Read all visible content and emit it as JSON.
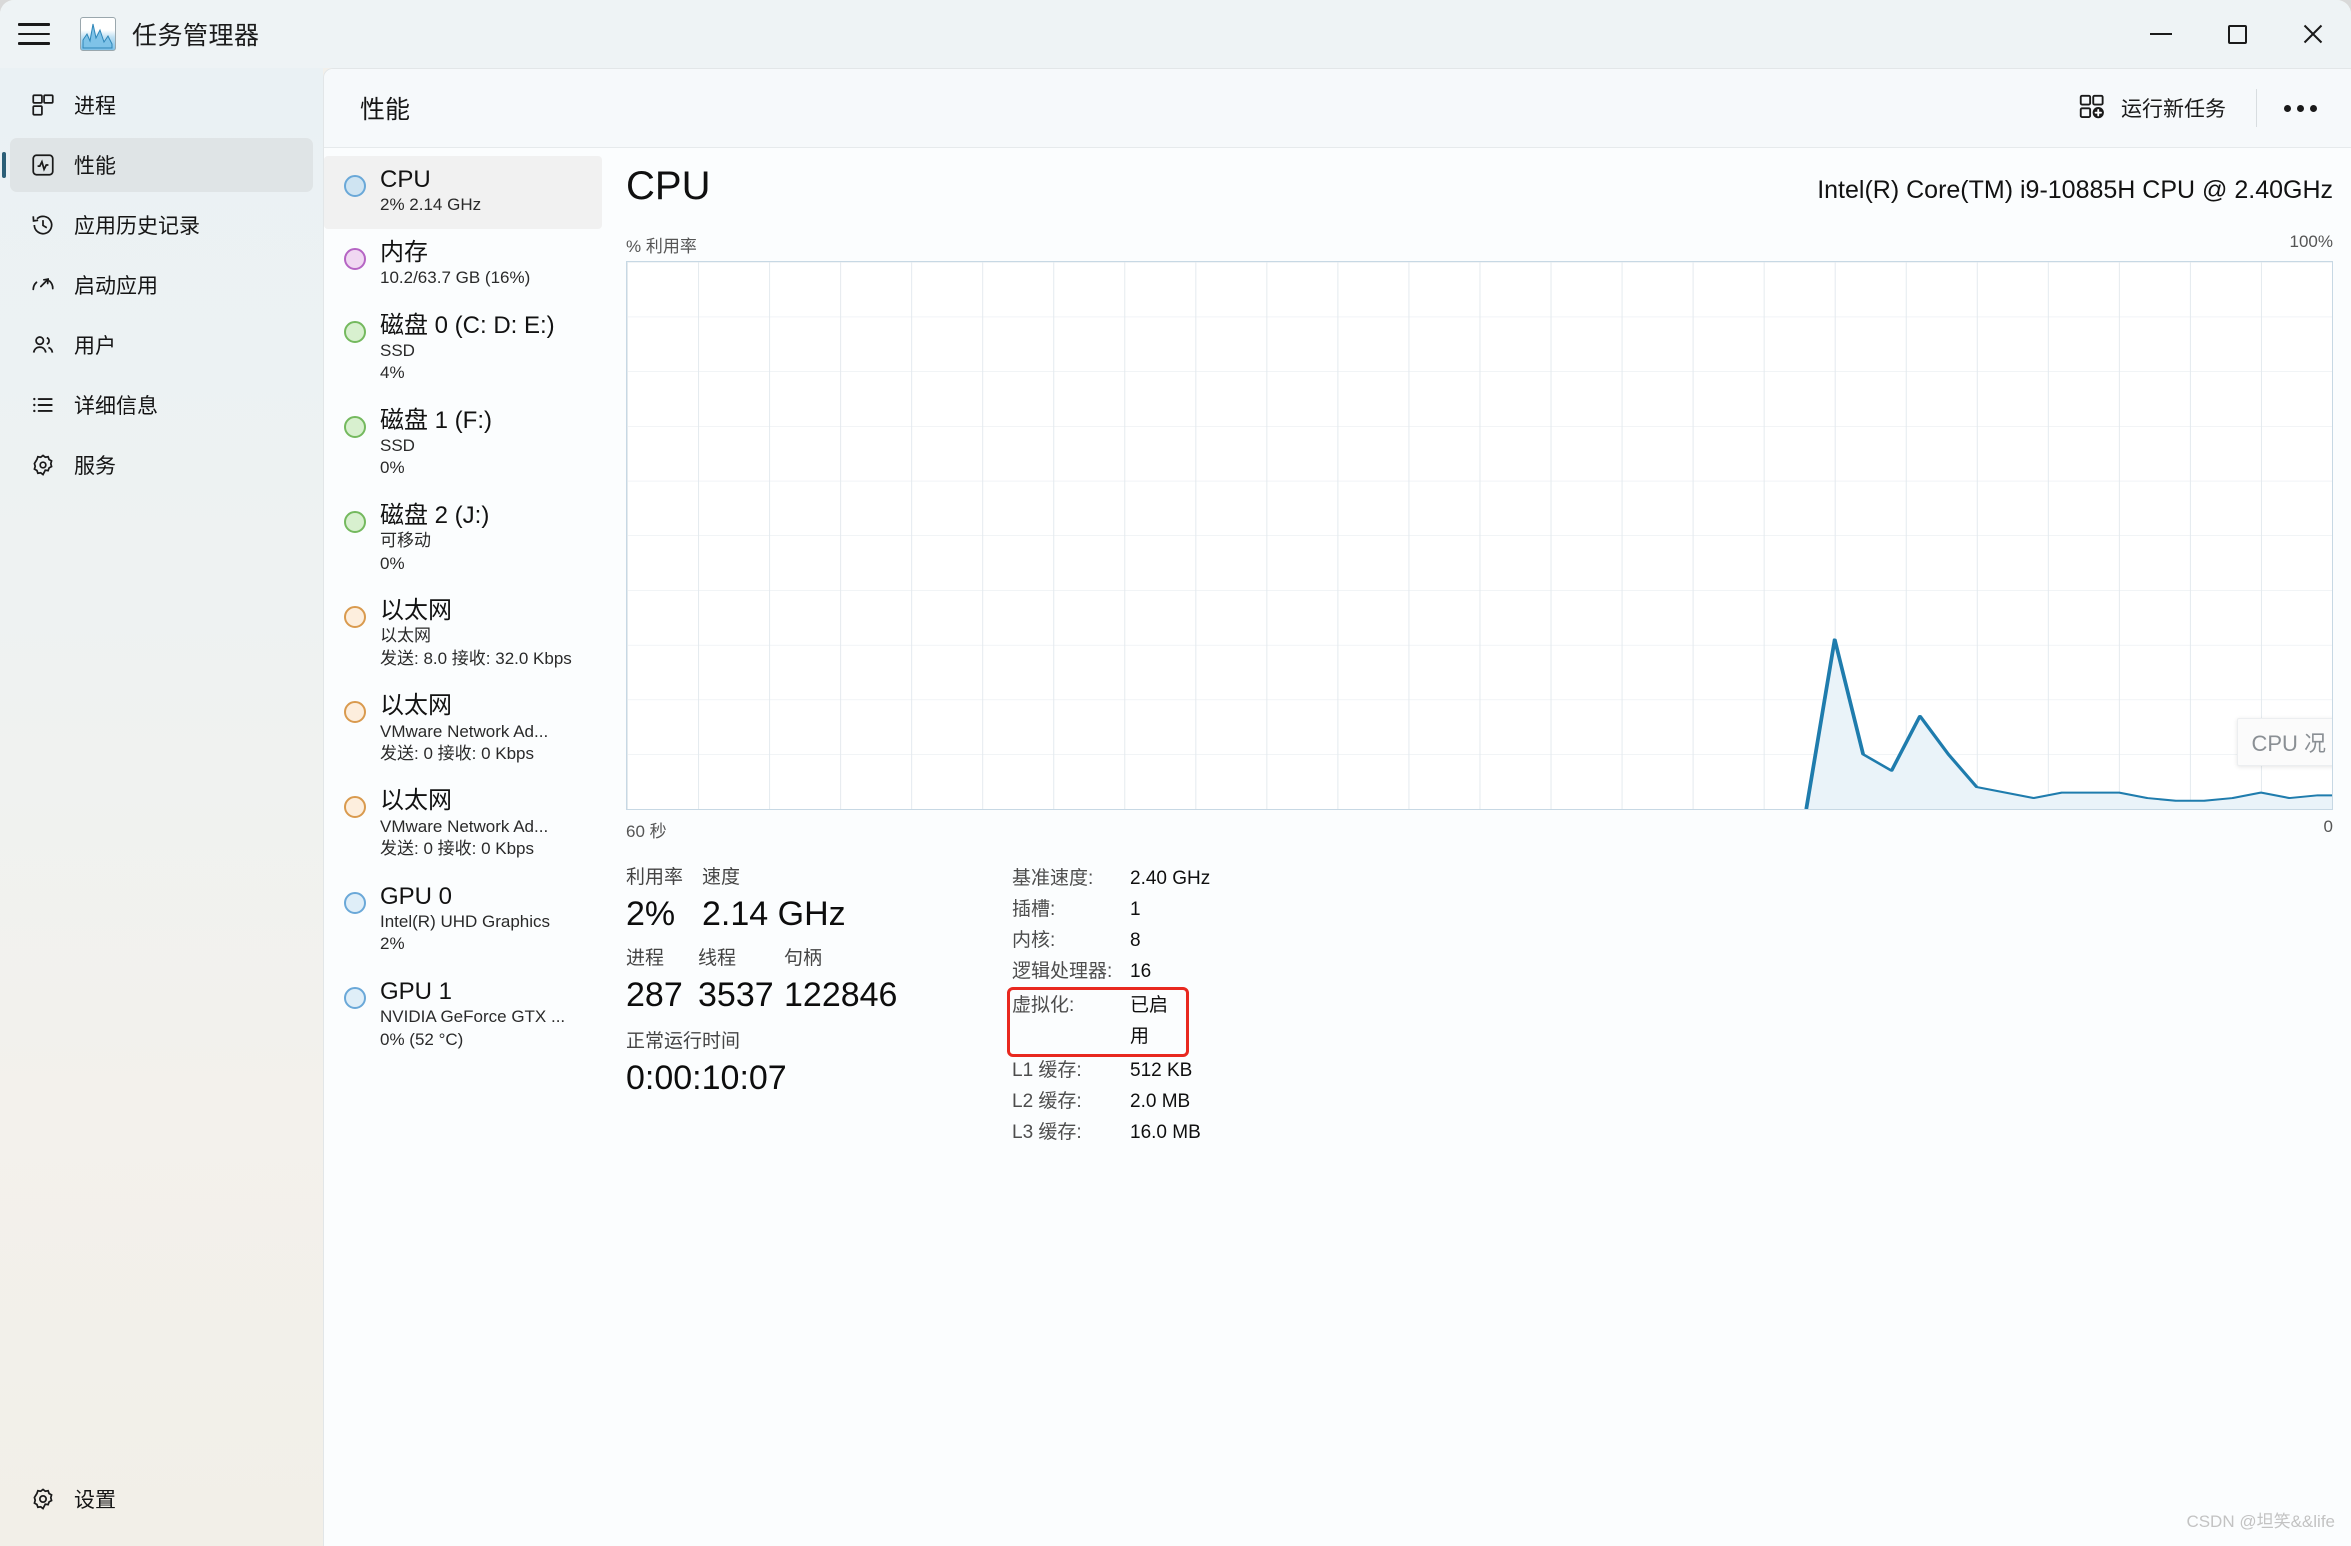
{
  "window": {
    "title": "任务管理器",
    "icon": "chart-app-icon",
    "controls": {
      "minimize": "最小化",
      "maximize": "最大化",
      "close": "关闭"
    }
  },
  "sidebar": {
    "items": [
      {
        "label": "进程",
        "icon": "processes-icon",
        "selected": false
      },
      {
        "label": "性能",
        "icon": "performance-icon",
        "selected": true
      },
      {
        "label": "应用历史记录",
        "icon": "history-icon",
        "selected": false
      },
      {
        "label": "启动应用",
        "icon": "startup-icon",
        "selected": false
      },
      {
        "label": "用户",
        "icon": "users-icon",
        "selected": false
      },
      {
        "label": "详细信息",
        "icon": "details-icon",
        "selected": false
      },
      {
        "label": "服务",
        "icon": "services-icon",
        "selected": false
      }
    ],
    "settings": {
      "label": "设置",
      "icon": "gear-icon"
    }
  },
  "header": {
    "page_title": "性能",
    "new_task_label": "运行新任务",
    "new_task_icon": "new-task-icon",
    "more_icon": "more-options-icon"
  },
  "perf_list": [
    {
      "name": "CPU",
      "lines": [
        "2%  2.14 GHz"
      ],
      "color": "#cfe4f2",
      "border": "#6aa8d8",
      "selected": true
    },
    {
      "name": "内存",
      "lines": [
        "10.2/63.7 GB (16%)"
      ],
      "color": "#f0d8f2",
      "border": "#b565c4",
      "selected": false
    },
    {
      "name": "磁盘 0 (C: D: E:)",
      "lines": [
        "SSD",
        "4%"
      ],
      "color": "#d8f0cf",
      "border": "#74b95e",
      "selected": false
    },
    {
      "name": "磁盘 1 (F:)",
      "lines": [
        "SSD",
        "0%"
      ],
      "color": "#d8f0cf",
      "border": "#74b95e",
      "selected": false
    },
    {
      "name": "磁盘 2 (J:)",
      "lines": [
        "可移动",
        "0%"
      ],
      "color": "#d8f0cf",
      "border": "#74b95e",
      "selected": false
    },
    {
      "name": "以太网",
      "lines": [
        "以太网",
        "发送: 8.0 接收: 32.0 Kbps"
      ],
      "color": "#fdeedd",
      "border": "#d99a4e",
      "selected": false
    },
    {
      "name": "以太网",
      "lines": [
        "VMware Network Ad...",
        "发送: 0 接收: 0 Kbps"
      ],
      "color": "#fdeedd",
      "border": "#d99a4e",
      "selected": false
    },
    {
      "name": "以太网",
      "lines": [
        "VMware Network Ad...",
        "发送: 0 接收: 0 Kbps"
      ],
      "color": "#fdeedd",
      "border": "#d99a4e",
      "selected": false
    },
    {
      "name": "GPU 0",
      "lines": [
        "Intel(R) UHD Graphics",
        "2%"
      ],
      "color": "#dfeef8",
      "border": "#6aa8d8",
      "selected": false
    },
    {
      "name": "GPU 1",
      "lines": [
        "NVIDIA GeForce GTX ...",
        "0%  (52 °C)"
      ],
      "color": "#dfeef8",
      "border": "#6aa8d8",
      "selected": false
    }
  ],
  "detail": {
    "title": "CPU",
    "model": "Intel(R) Core(TM) i9-10885H CPU @ 2.40GHz",
    "y_axis_label": "% 利用率",
    "y_axis_max": "100%",
    "x_axis_left": "60 秒",
    "x_axis_right": "0",
    "graph_tooltip": "CPU 况",
    "stats": {
      "utilization": {
        "label": "利用率",
        "value": "2%"
      },
      "speed": {
        "label": "速度",
        "value": "2.14 GHz"
      },
      "processes": {
        "label": "进程",
        "value": "287"
      },
      "threads": {
        "label": "线程",
        "value": "3537"
      },
      "handles": {
        "label": "句柄",
        "value": "122846"
      },
      "uptime": {
        "label": "正常运行时间",
        "value": "0:00:10:07"
      }
    },
    "specs": [
      {
        "key": "基准速度:",
        "value": "2.40 GHz",
        "highlighted": false
      },
      {
        "key": "插槽:",
        "value": "1",
        "highlighted": false
      },
      {
        "key": "内核:",
        "value": "8",
        "highlighted": false
      },
      {
        "key": "逻辑处理器:",
        "value": "16",
        "highlighted": false
      },
      {
        "key": "虚拟化:",
        "value": "已启用",
        "highlighted": true
      },
      {
        "key": "L1 缓存:",
        "value": "512 KB",
        "highlighted": false
      },
      {
        "key": "L2 缓存:",
        "value": "2.0 MB",
        "highlighted": false
      },
      {
        "key": "L3 缓存:",
        "value": "16.0 MB",
        "highlighted": false
      }
    ]
  },
  "watermark": "CSDN @坦笑&&life",
  "colors": {
    "accent": "#2b5f78",
    "graph_line": "#1f7cad",
    "graph_fill": "#eaf3f9",
    "grid": "#e3e9ee",
    "highlight_box": "#e8281f"
  },
  "chart_data": {
    "type": "area",
    "title": "CPU",
    "xlabel": "60 秒",
    "ylabel": "% 利用率",
    "ylim": [
      0,
      100
    ],
    "xlim": [
      60,
      0
    ],
    "grid": true,
    "legend": "none",
    "note": "只有最近约 18 秒有数据；更早的区段为空白。",
    "x_seconds_ago": [
      18.5,
      17.5,
      16.5,
      15.5,
      14.5,
      13.5,
      12.5,
      11.5,
      10.5,
      9.5,
      8.5,
      7.5,
      6.5,
      5.5,
      4.5,
      3.5,
      2.5,
      1.5,
      0.5,
      0
    ],
    "values": [
      0,
      31,
      10,
      7,
      17,
      10,
      4,
      3,
      2,
      3,
      3,
      3,
      2,
      1.5,
      1.5,
      2,
      3,
      2,
      2.5,
      2.5
    ]
  }
}
